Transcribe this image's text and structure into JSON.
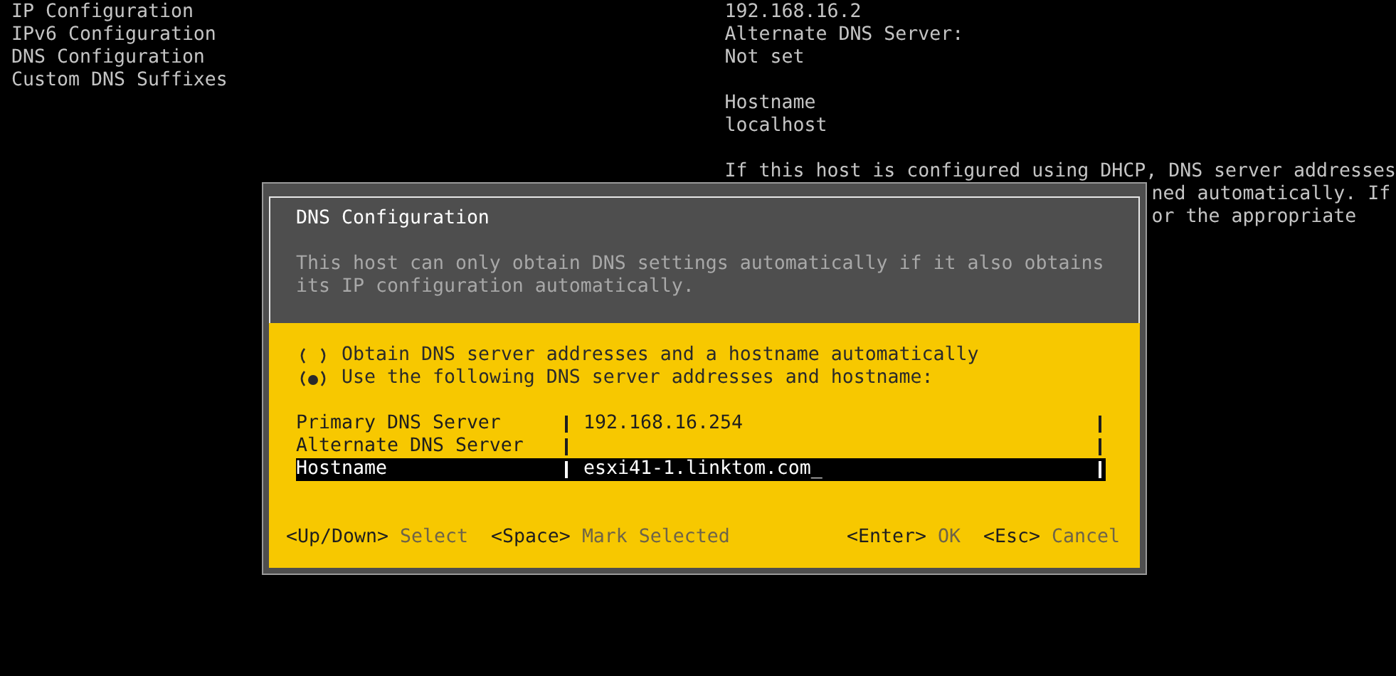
{
  "menu": [
    {
      "label": "IP Configuration"
    },
    {
      "label": "IPv6 Configuration"
    },
    {
      "label": "DNS Configuration"
    },
    {
      "label": "Custom DNS Suffixes"
    }
  ],
  "info": {
    "blocks": [
      [
        "192.168.16.2",
        "Alternate DNS Server:",
        "Not set"
      ],
      [
        "Hostname",
        "localhost"
      ],
      [
        "If this host is configured using DHCP, DNS server addresses"
      ]
    ],
    "covered_lines": [
      "ned automatically. If",
      "or the appropriate"
    ]
  },
  "dialog": {
    "title": "DNS Configuration",
    "description": "This host can only obtain DNS settings automatically if it also obtains its IP configuration automatically.",
    "options": [
      {
        "label": "Obtain DNS server addresses and a hostname automatically",
        "selected": false
      },
      {
        "label": "Use the following DNS server addresses and hostname:",
        "selected": true
      }
    ],
    "fields": [
      {
        "label": "Primary DNS Server",
        "value": "192.168.16.254",
        "selected": false
      },
      {
        "label": "Alternate DNS Server",
        "selected": false
      },
      {
        "label": "Hostname",
        "value": "esxi41-1.linktom.com_",
        "selected": true
      }
    ],
    "footer_left": [
      {
        "key": "<Up/Down>",
        "action": "Select"
      },
      {
        "key": "<Space>",
        "action": "Mark Selected"
      }
    ],
    "footer_right": [
      {
        "key": "<Enter>",
        "action": "OK"
      },
      {
        "key": "<Esc>",
        "action": "Cancel"
      }
    ]
  }
}
